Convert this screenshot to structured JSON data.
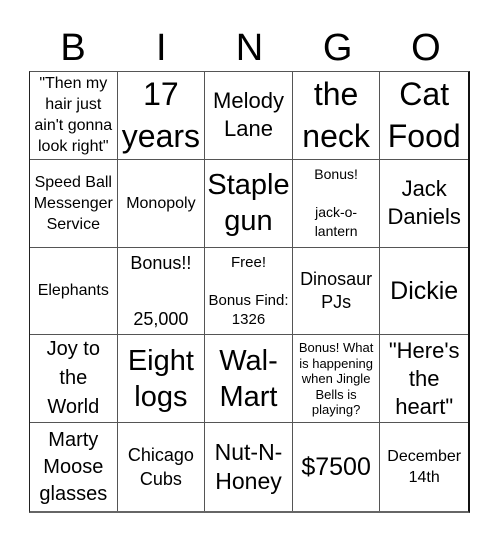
{
  "header": {
    "letters": [
      "B",
      "I",
      "N",
      "G",
      "O"
    ]
  },
  "card": {
    "cells": [
      "\"Then my hair just ain't gonna look right\"",
      "17 years",
      "Melody Lane",
      "the neck",
      "Cat Food",
      "Speed Ball Messenger Service",
      "Monopoly",
      "Staple gun",
      "Bonus!\n\njack-o-\nlantern",
      "Jack Daniels",
      "Elephants",
      "Bonus!!\n\n25,000",
      "Free!\n\nBonus Find: 1326",
      "Dinosaur PJs",
      "Dickie",
      "Joy to the World",
      "Eight logs",
      "Wal-Mart",
      "Bonus! What is happening when Jingle Bells is playing?",
      "\"Here's the heart\"",
      "Marty Moose glasses",
      "Chicago Cubs",
      "Nut-N-Honey",
      "$7500",
      "December 14th"
    ]
  }
}
